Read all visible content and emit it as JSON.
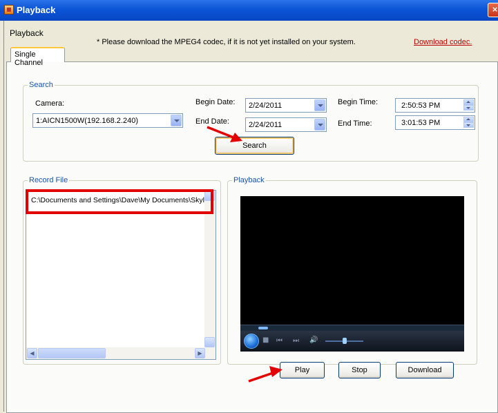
{
  "window": {
    "title": "Playback",
    "close_glyph": "×"
  },
  "header": {
    "section_label": "Playback",
    "codec_notice": "* Please download the MPEG4 codec, if it is not yet installed on your system.",
    "download_codec_link": "Download codec."
  },
  "tabs": [
    {
      "label": "Single Channel",
      "selected": true
    }
  ],
  "search": {
    "group_title": "Search",
    "camera_label": "Camera:",
    "camera_value": "1:AICN1500W(192.168.2.240)",
    "begin_date_label": "Begin Date:",
    "begin_date_value": "2/24/2011",
    "end_date_label": "End Date:",
    "end_date_value": "2/24/2011",
    "begin_time_label": "Begin Time:",
    "begin_time_value": "2:50:53 PM",
    "end_time_label": "End Time:",
    "end_time_value": "3:01:53 PM",
    "search_button": "Search"
  },
  "record_file": {
    "group_title": "Record File",
    "items": [
      "C:\\Documents and Settings\\Dave\\My Documents\\Skyl"
    ]
  },
  "playback": {
    "group_title": "Playback",
    "play_button": "Play",
    "stop_button": "Stop",
    "download_button": "Download",
    "volume_level": 0.45
  },
  "icons": {
    "player_stop": "■",
    "player_prev": "⏮",
    "player_next": "⏭",
    "player_volume": "🔊",
    "scroll_left": "◀",
    "scroll_right": "▶",
    "scroll_up": "▲",
    "scroll_down": "▼"
  },
  "colors": {
    "annotation_red": "#e30000",
    "link_red": "#c00000",
    "group_title_blue": "#1e52a6"
  }
}
